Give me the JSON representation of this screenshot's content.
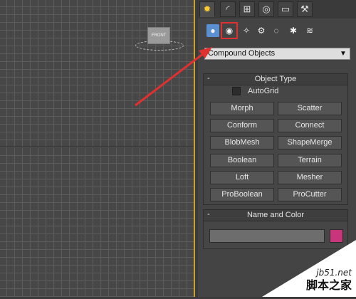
{
  "viewport": {
    "viewcube_label": "FRONT"
  },
  "command_panel": {
    "tabs": [
      {
        "icon": "create-icon",
        "active": true
      },
      {
        "icon": "modify-icon"
      },
      {
        "icon": "hierarchy-icon"
      },
      {
        "icon": "motion-icon"
      },
      {
        "icon": "display-icon"
      },
      {
        "icon": "utilities-icon"
      }
    ],
    "categories": [
      {
        "icon": "geometry-icon",
        "selected": true
      },
      {
        "icon": "shapes-icon",
        "highlighted": true
      },
      {
        "icon": "lights-icon"
      },
      {
        "icon": "cameras-icon"
      },
      {
        "icon": "helpers-icon"
      },
      {
        "icon": "space-warps-icon"
      },
      {
        "icon": "systems-icon"
      }
    ],
    "dropdown": {
      "selected": "Compound Objects"
    },
    "object_type": {
      "title": "Object Type",
      "collapse": "-",
      "autogrid": "AutoGrid",
      "buttons": [
        "Morph",
        "Scatter",
        "Conform",
        "Connect",
        "BlobMesh",
        "ShapeMerge",
        "Boolean",
        "Terrain",
        "Loft",
        "Mesher",
        "ProBoolean",
        "ProCutter"
      ]
    },
    "name_color": {
      "title": "Name and Color",
      "collapse": "-",
      "name_value": "",
      "color": "#c8357c"
    }
  },
  "watermark": {
    "site": "jb51.net",
    "chinese": "脚本之家"
  },
  "colors": {
    "highlight": "#e03030",
    "active_tab": "#ffcc33",
    "viewport_border": "#c9a227"
  }
}
